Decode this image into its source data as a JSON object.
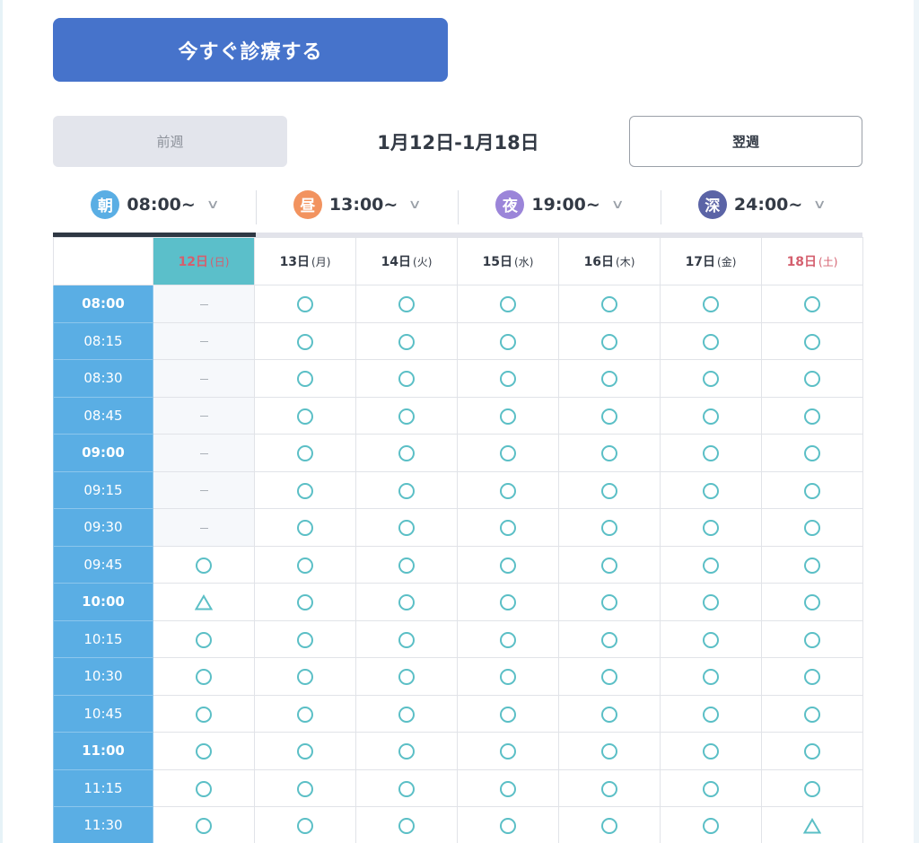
{
  "consult_button": {
    "label": "今すぐ診療する"
  },
  "week_nav": {
    "prev_label": "前週",
    "range": "1月12日-1月18日",
    "next_label": "翌週"
  },
  "time_slots": [
    {
      "badge": "朝",
      "time": "08:00~",
      "color": "#5aaee4",
      "active": true
    },
    {
      "badge": "昼",
      "time": "13:00~",
      "color": "#f2935f",
      "active": false
    },
    {
      "badge": "夜",
      "time": "19:00~",
      "color": "#9b85d9",
      "active": false
    },
    {
      "badge": "深",
      "time": "24:00~",
      "color": "#5b64a6",
      "active": false
    }
  ],
  "days": [
    {
      "date": "12日",
      "weekday": "(日)",
      "today": true,
      "saturday": false
    },
    {
      "date": "13日",
      "weekday": "(月)",
      "today": false,
      "saturday": false
    },
    {
      "date": "14日",
      "weekday": "(火)",
      "today": false,
      "saturday": false
    },
    {
      "date": "15日",
      "weekday": "(水)",
      "today": false,
      "saturday": false
    },
    {
      "date": "16日",
      "weekday": "(木)",
      "today": false,
      "saturday": false
    },
    {
      "date": "17日",
      "weekday": "(金)",
      "today": false,
      "saturday": false
    },
    {
      "date": "18日",
      "weekday": "(土)",
      "today": false,
      "saturday": true
    }
  ],
  "rows": [
    {
      "time": "08:00",
      "hour": true,
      "cells": [
        "－",
        "○",
        "○",
        "○",
        "○",
        "○",
        "○"
      ]
    },
    {
      "time": "08:15",
      "hour": false,
      "cells": [
        "－",
        "○",
        "○",
        "○",
        "○",
        "○",
        "○"
      ]
    },
    {
      "time": "08:30",
      "hour": false,
      "cells": [
        "－",
        "○",
        "○",
        "○",
        "○",
        "○",
        "○"
      ]
    },
    {
      "time": "08:45",
      "hour": false,
      "cells": [
        "－",
        "○",
        "○",
        "○",
        "○",
        "○",
        "○"
      ]
    },
    {
      "time": "09:00",
      "hour": true,
      "cells": [
        "－",
        "○",
        "○",
        "○",
        "○",
        "○",
        "○"
      ]
    },
    {
      "time": "09:15",
      "hour": false,
      "cells": [
        "－",
        "○",
        "○",
        "○",
        "○",
        "○",
        "○"
      ]
    },
    {
      "time": "09:30",
      "hour": false,
      "cells": [
        "－",
        "○",
        "○",
        "○",
        "○",
        "○",
        "○"
      ]
    },
    {
      "time": "09:45",
      "hour": false,
      "cells": [
        "○",
        "○",
        "○",
        "○",
        "○",
        "○",
        "○"
      ]
    },
    {
      "time": "10:00",
      "hour": true,
      "cells": [
        "△",
        "○",
        "○",
        "○",
        "○",
        "○",
        "○"
      ]
    },
    {
      "time": "10:15",
      "hour": false,
      "cells": [
        "○",
        "○",
        "○",
        "○",
        "○",
        "○",
        "○"
      ]
    },
    {
      "time": "10:30",
      "hour": false,
      "cells": [
        "○",
        "○",
        "○",
        "○",
        "○",
        "○",
        "○"
      ]
    },
    {
      "time": "10:45",
      "hour": false,
      "cells": [
        "○",
        "○",
        "○",
        "○",
        "○",
        "○",
        "○"
      ]
    },
    {
      "time": "11:00",
      "hour": true,
      "cells": [
        "○",
        "○",
        "○",
        "○",
        "○",
        "○",
        "○"
      ]
    },
    {
      "time": "11:15",
      "hour": false,
      "cells": [
        "○",
        "○",
        "○",
        "○",
        "○",
        "○",
        "○"
      ]
    },
    {
      "time": "11:30",
      "hour": false,
      "cells": [
        "○",
        "○",
        "○",
        "○",
        "○",
        "○",
        "△"
      ]
    }
  ],
  "colors": {
    "primary": "#4673cb",
    "time_column": "#5aaee4",
    "available": "#5bbfc6",
    "today_header": "#5bbfca",
    "weekend_red": "#d45f6e"
  }
}
